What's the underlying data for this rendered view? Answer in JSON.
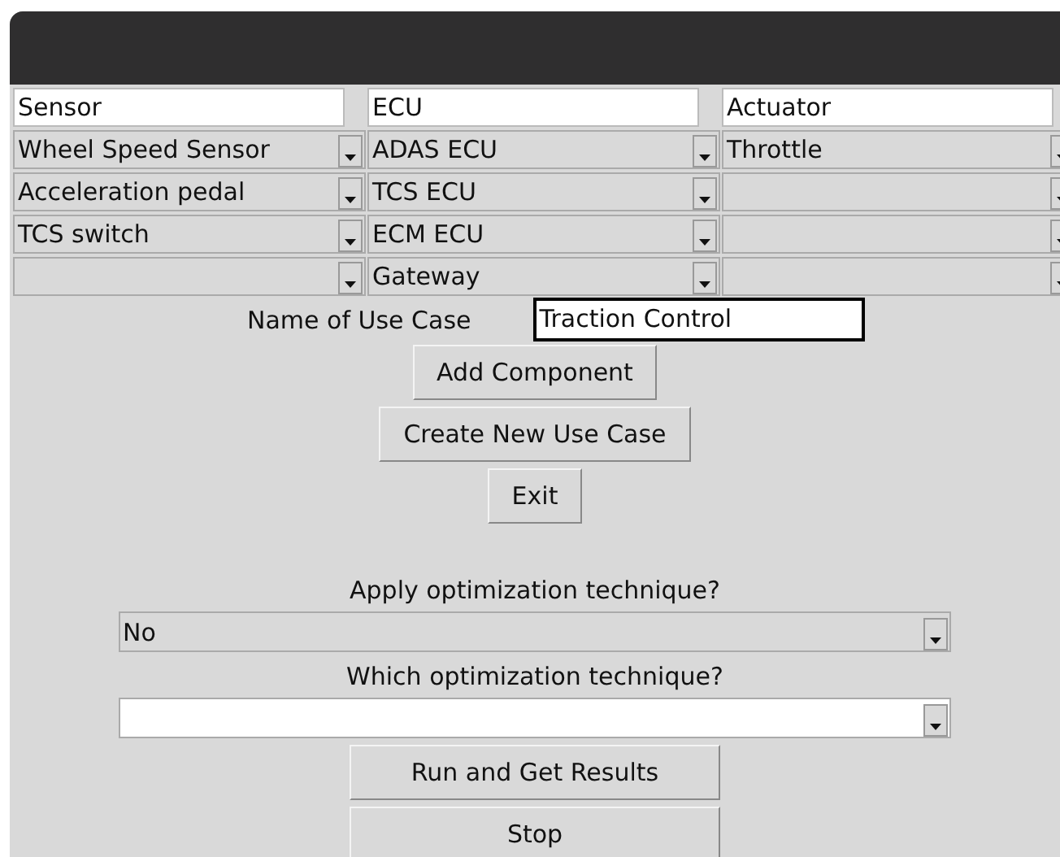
{
  "columns": [
    {
      "header": "Sensor",
      "items": [
        {
          "kind": "combobox",
          "value": "Wheel Speed Sensor"
        },
        {
          "kind": "combobox",
          "value": "Acceleration pedal"
        },
        {
          "kind": "combobox",
          "value": "TCS switch"
        },
        {
          "kind": "combobox"
        }
      ]
    },
    {
      "header": "ECU",
      "items": [
        {
          "kind": "combobox",
          "value": "ADAS ECU"
        },
        {
          "kind": "combobox",
          "value": "TCS ECU"
        },
        {
          "kind": "combobox",
          "value": "ECM ECU"
        },
        {
          "kind": "combobox",
          "value": "Gateway"
        }
      ]
    },
    {
      "header": "Actuator",
      "items": [
        {
          "kind": "combobox",
          "value": "Throttle"
        },
        {
          "kind": "combobox"
        },
        {
          "kind": "combobox"
        },
        {
          "kind": "combobox"
        }
      ]
    }
  ],
  "use_case": {
    "label": "Name of Use Case",
    "value": "Traction Control"
  },
  "buttons": [
    "Add Component",
    "Create New Use Case",
    "Exit"
  ],
  "options": [
    {
      "label": "Apply optimization technique?",
      "kind": "readonly",
      "value": "No"
    },
    {
      "label": "Which optimization technique?",
      "kind": "editable"
    }
  ],
  "action_buttons": [
    "Run and Get Results",
    "Stop"
  ]
}
